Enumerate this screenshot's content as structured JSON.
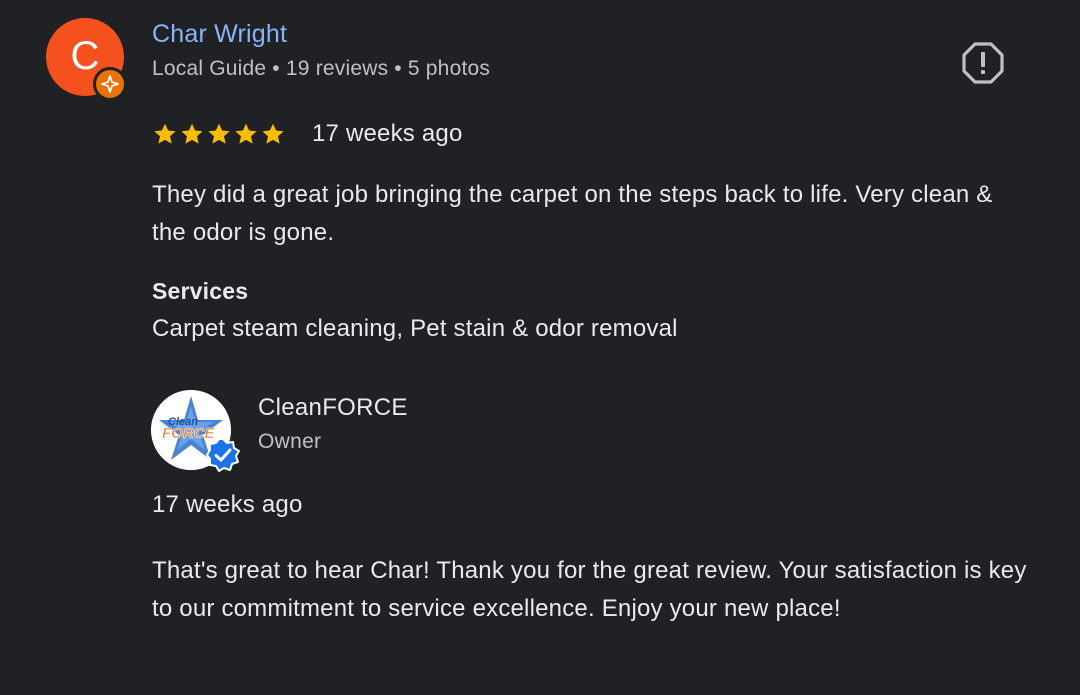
{
  "review": {
    "avatar_letter": "C",
    "avatar_color": "#f4511e",
    "reviewer_name": "Char Wright",
    "reviewer_meta": "Local Guide • 19 reviews • 5 photos",
    "badge_icon": "local-guide-star-icon",
    "report_icon": "report-octagon-icon",
    "rating": 5,
    "rating_max": 5,
    "star_color": "#fbbc04",
    "age": "17 weeks ago",
    "text": "They did a great job bringing the carpet on the steps back to life. Very clean & the odor is gone.",
    "services_title": "Services",
    "services": "Carpet steam cleaning, Pet stain & odor removal"
  },
  "owner_reply": {
    "logo_text_top": "Clean",
    "logo_text_bottom": "FORCE",
    "verified_icon": "verified-check-icon",
    "owner_name": "CleanFORCE",
    "owner_role": "Owner",
    "age": "17 weeks ago",
    "text": "That's great to hear Char! Thank you for the great review. Your satisfaction is key to our commitment to service excellence. Enjoy your new place!"
  },
  "colors": {
    "background": "#202124",
    "name_link": "#8ab4f8",
    "primary_text": "#e8eaed",
    "secondary_text": "#bdc1c6",
    "verified_blue": "#1a73e8"
  }
}
